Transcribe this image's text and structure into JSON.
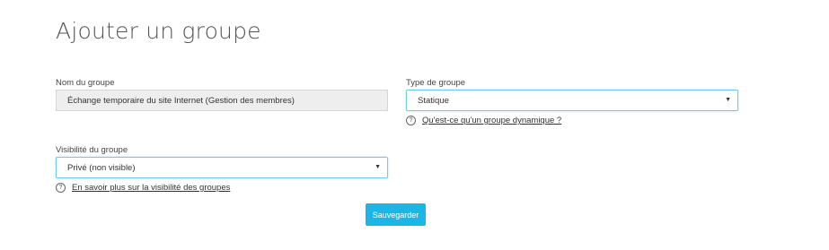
{
  "page": {
    "title": "Ajouter un groupe"
  },
  "form": {
    "group_name": {
      "label": "Nom du groupe",
      "value": "Échange temporaire du site Internet (Gestion des membres)"
    },
    "group_type": {
      "label": "Type de groupe",
      "selected": "Statique",
      "help_link": "Qu'est-ce qu'un groupe dynamique ?"
    },
    "visibility": {
      "label": "Visibilité du groupe",
      "selected": "Privé (non visible)",
      "help_link": "En savoir plus sur la visibilité des groupes"
    },
    "save_label": "Sauvegarder"
  },
  "icons": {
    "help": "?",
    "dropdown": "▼"
  },
  "colors": {
    "accent": "#1cb6e6",
    "focus_border": "#6ecde6",
    "readonly_bg": "#eeeeee"
  }
}
